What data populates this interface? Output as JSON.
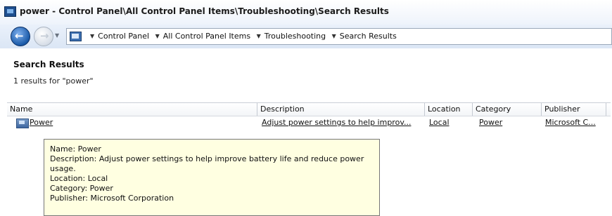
{
  "window": {
    "title": "power - Control Panel\\All Control Panel Items\\Troubleshooting\\Search Results"
  },
  "navigation": {
    "breadcrumb": [
      "Control Panel",
      "All Control Panel Items",
      "Troubleshooting",
      "Search Results"
    ]
  },
  "main": {
    "heading": "Search Results",
    "result_summary": "1 results for \"power\"",
    "columns": [
      "Name",
      "Description",
      "Location",
      "Category",
      "Publisher"
    ],
    "rows": [
      {
        "name": "Power",
        "description": "Adjust power settings to help improv...",
        "location": "Local",
        "category": "Power",
        "publisher": "Microsoft C..."
      }
    ]
  },
  "tooltip": {
    "name_line": "Name: Power",
    "description_line": "Description: Adjust power settings to help improve battery life and reduce power usage.",
    "location_line": "Location: Local",
    "category_line": "Category: Power",
    "publisher_line": "Publisher: Microsoft Corporation"
  },
  "icons": {
    "window": "control-panel-icon",
    "back": "back-arrow-icon",
    "forward": "forward-arrow-icon",
    "row": "troubleshooter-icon"
  }
}
